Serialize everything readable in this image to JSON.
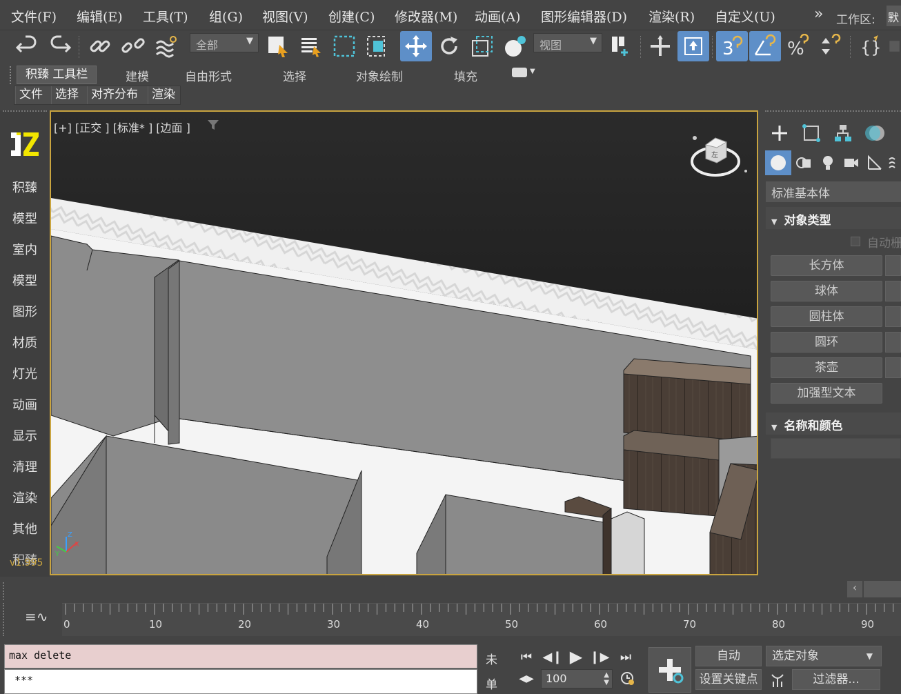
{
  "menu": {
    "items": [
      "文件(F)",
      "编辑(E)",
      "工具(T)",
      "组(G)",
      "视图(V)",
      "创建(C)",
      "修改器(M)",
      "动画(A)",
      "图形编辑器(D)",
      "渲染(R)",
      "自定义(U)"
    ],
    "workspace_label": "工作区:",
    "workspace_value": "默"
  },
  "toolbar": {
    "selection_filter": "全部",
    "reference_coord": "视图",
    "active_color": "#5e8fc8"
  },
  "ribbon": {
    "tabs": [
      "积臻 工具栏",
      "建模",
      "自由形式",
      "选择",
      "对象绘制",
      "填充"
    ],
    "sub_tabs": [
      "文件",
      "选择",
      "对齐分布",
      "渲染"
    ]
  },
  "sidebar": {
    "items": [
      "积臻",
      "模型",
      "室内",
      "模型",
      "图形",
      "材质",
      "灯光",
      "动画",
      "显示",
      "清理",
      "渲染",
      "其他",
      "积臻"
    ],
    "version": "v1.995"
  },
  "viewport": {
    "labels": "[+] [正交 ] [标准* ] [边面 ]",
    "viewcube_face": "左",
    "border_color": "#c9a43f"
  },
  "command_panel": {
    "category": "标准基本体",
    "rollout_object_type": "对象类型",
    "autogrid": "自动栅格",
    "buttons": [
      "长方体",
      "球体",
      "圆柱体",
      "圆环",
      "茶壶",
      "加强型文本"
    ],
    "rollout_name_color": "名称和颜色"
  },
  "timeline": {
    "ticks": [
      "0",
      "10",
      "20",
      "30",
      "40",
      "50",
      "60",
      "70",
      "80",
      "90"
    ]
  },
  "status": {
    "script_input": "max delete",
    "script_output": "***",
    "status_left_top": "未",
    "status_left_bottom": "单",
    "frame_value": "100",
    "auto_key": "自动",
    "set_key": "设置关键点",
    "selection_set": "选定对象",
    "filters": "过滤器..."
  }
}
